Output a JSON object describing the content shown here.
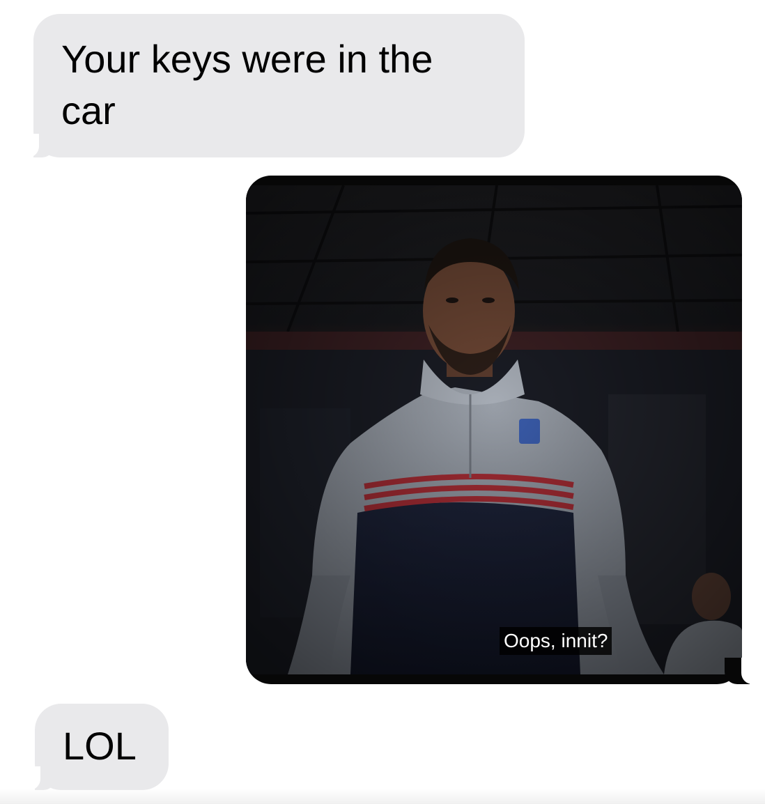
{
  "messages": [
    {
      "direction": "received",
      "text": "Your keys were in the car"
    },
    {
      "direction": "sent",
      "type": "image",
      "subtitle": "Oops, innit?"
    },
    {
      "direction": "received",
      "text": "LOL"
    }
  ],
  "colors": {
    "received_bubble": "#e9e9eb",
    "background": "#ffffff",
    "image_frame": "#070707"
  }
}
